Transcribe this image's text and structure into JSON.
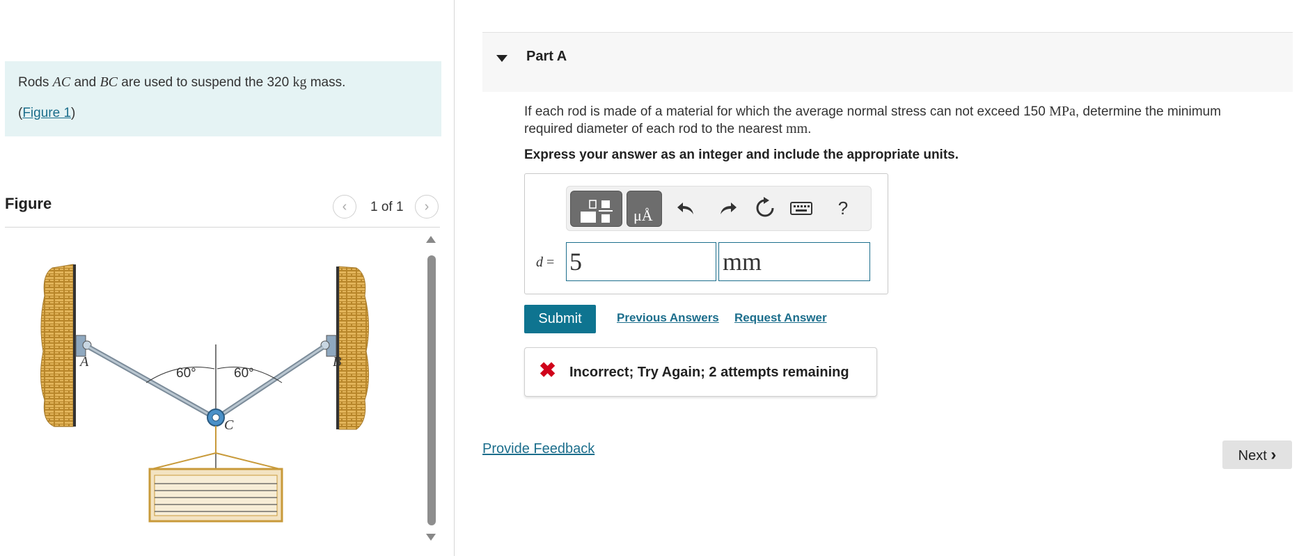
{
  "intro": {
    "text_prefix": "Rods ",
    "rod1": "AC",
    "text_and": " and ",
    "rod2": "BC",
    "text_middle": " are used to suspend the 320 ",
    "mass_unit": "kg",
    "text_suffix": " mass.",
    "figure_link_open": "(",
    "figure_link": "Figure 1",
    "figure_link_close": ")"
  },
  "figure": {
    "title": "Figure",
    "pager": "1 of 1",
    "prev_icon": "chevron-left-icon",
    "next_icon": "chevron-right-icon",
    "labels": {
      "point_a": "A",
      "point_b": "B",
      "point_c": "C",
      "angle_left": "60°",
      "angle_right": "60°"
    }
  },
  "part": {
    "title": "Part A",
    "question_prefix": "If each rod is made of a material for which the average normal stress can not exceed 150 ",
    "stress_unit": "MPa",
    "question_middle": ", determine the minimum required diameter of each rod to the nearest ",
    "length_unit": "mm",
    "question_suffix": ".",
    "instruction": "Express your answer as an integer and include the appropriate units."
  },
  "toolbar": {
    "templates_icon": "templates-icon",
    "units_icon": "units-icon",
    "units_label": "μÅ",
    "undo_icon": "undo-icon",
    "redo_icon": "redo-icon",
    "reset_icon": "reset-icon",
    "keyboard_icon": "keyboard-icon",
    "help_label": "?"
  },
  "answer": {
    "variable": "d",
    "equals": " =",
    "value": "5",
    "unit": "mm"
  },
  "actions": {
    "submit_label": "Submit",
    "previous_answers_label": "Previous Answers",
    "request_answer_label": "Request Answer"
  },
  "feedback": {
    "icon": "✖",
    "message": "Incorrect; Try Again; 2 attempts remaining"
  },
  "footer": {
    "provide_feedback_label": "Provide Feedback",
    "next_label": "Next",
    "next_icon": "›"
  },
  "colors": {
    "accent": "#0e7490",
    "link": "#1c6e8c",
    "error": "#d0021b",
    "intro_bg": "#e5f3f4"
  }
}
